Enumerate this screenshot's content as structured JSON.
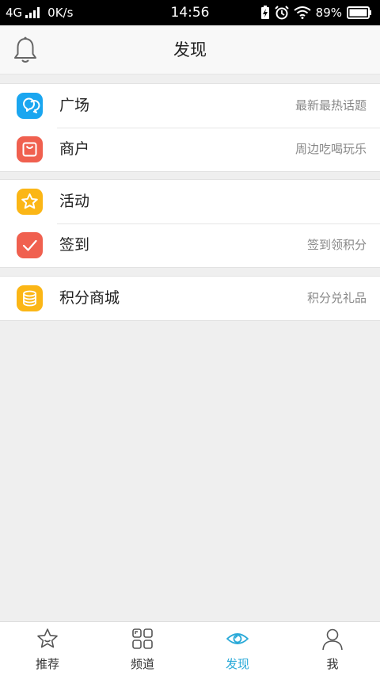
{
  "status_bar": {
    "network": "4G",
    "speed": "0K/s",
    "time": "14:56",
    "battery": "89%"
  },
  "header": {
    "title": "发现",
    "icon": "bell-icon"
  },
  "groups": [
    {
      "items": [
        {
          "label": "广场",
          "subtitle": "最新最热话题",
          "icon": "chat-bubbles-icon",
          "color": "#1aa6f0"
        },
        {
          "label": "商户",
          "subtitle": "周边吃喝玩乐",
          "icon": "shopping-bag-icon",
          "color": "#f0604f"
        }
      ]
    },
    {
      "items": [
        {
          "label": "活动",
          "subtitle": "",
          "icon": "star-icon",
          "color": "#fbb616"
        },
        {
          "label": "签到",
          "subtitle": "签到领积分",
          "icon": "checkmark-icon",
          "color": "#f0604f"
        }
      ]
    },
    {
      "items": [
        {
          "label": "积分商城",
          "subtitle": "积分兑礼品",
          "icon": "coins-icon",
          "color": "#fbb616"
        }
      ]
    }
  ],
  "tabs": [
    {
      "label": "推荐",
      "icon": "star-outline-icon",
      "active": false
    },
    {
      "label": "频道",
      "icon": "grid-icon",
      "active": false
    },
    {
      "label": "发现",
      "icon": "eye-icon",
      "active": true
    },
    {
      "label": "我",
      "icon": "person-icon",
      "active": false
    }
  ],
  "colors": {
    "accent": "#29a9d8",
    "background": "#efefef"
  }
}
